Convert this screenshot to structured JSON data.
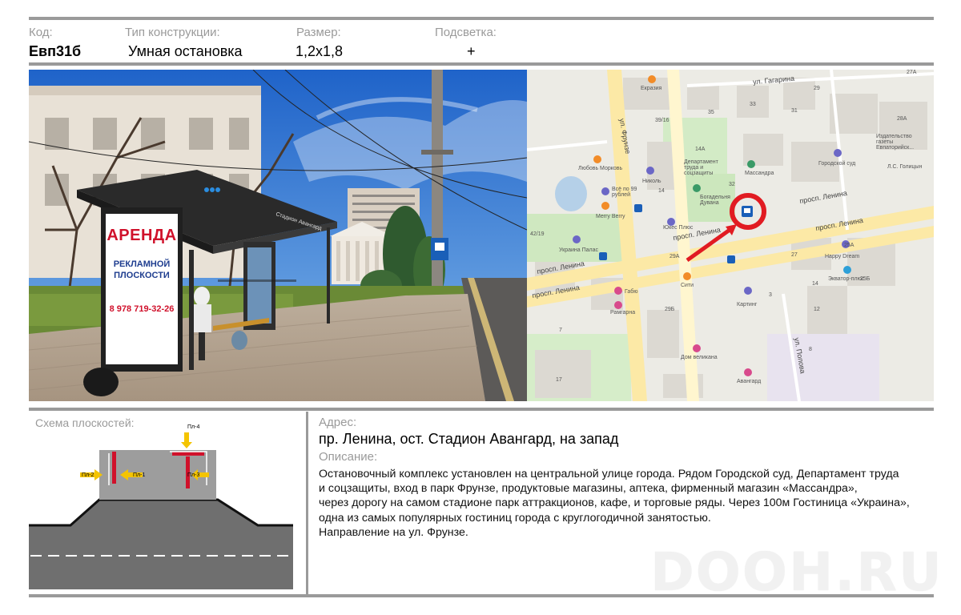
{
  "header": {
    "code_label": "Код:",
    "code_value": "Евп31б",
    "type_label": "Тип конструкции:",
    "type_value": "Умная остановка",
    "size_label": "Размер:",
    "size_value": "1,2x1,8",
    "light_label": "Подсветка:",
    "light_value": "+"
  },
  "photo": {
    "billboard_line1": "АРЕНДА",
    "billboard_line2": "РЕКЛАМНОЙ",
    "billboard_line3": "ПЛОСКОСТИ",
    "billboard_phone": "8 978 719-32-26",
    "shelter_sign": "Стадион Авангард"
  },
  "map": {
    "streets": {
      "lenina_1": "просп. Ленина",
      "lenina_2": "просп. Ленина",
      "lenina_3": "просп. Ленина",
      "lenina_4": "просп. Ленина",
      "frunze": "ул. Фрунзе",
      "gagarina": "ул. Гагарина",
      "popova": "ул. Попова"
    },
    "places": {
      "ekrazia": "Екразия",
      "lyubov": "Любовь Морковь",
      "nikol": "Николь",
      "vse99": "Всё по 99 рублей",
      "merry": "Merry Berry",
      "department": "Департамент труда и соцзащиты",
      "massandra": "Массандра",
      "dubrava": "Богадельня Дувана",
      "sud": "Городской суд",
      "izdatelstvo": "Издательство газеты Евпаторийск...",
      "golitsyn": "Л.С. Голицын",
      "ukraina": "Украина Палас",
      "yukes": "Юкес Плюс",
      "happy": "Happy Dream",
      "sity": "Сити",
      "fabio": "Габю",
      "ramgarna": "Рамгарна",
      "karting": "Картинг",
      "ekvator": "Экватор-плюс",
      "dom_velikana": "Дом великана",
      "avangard": "Авангард"
    },
    "numbers": {
      "n29": "29",
      "n33": "33",
      "n35": "35",
      "n31": "31",
      "n3916": "39/16",
      "n14a": "14А",
      "n28a": "28А",
      "n27a": "27А",
      "n14": "14",
      "n32": "32",
      "n4219": "42/19",
      "n29a": "29А",
      "n27": "27",
      "n25a": "25А",
      "n25b": "25Б",
      "n14b": "14",
      "n12": "12",
      "n8": "8",
      "n3": "3",
      "n29b": "29Б",
      "n17": "17",
      "n7": "7"
    }
  },
  "scheme": {
    "title": "Схема плоскостей:",
    "p1": "Пл-1",
    "p2": "Пл-2",
    "p3": "Пл-3",
    "p4": "Пл-4"
  },
  "address": {
    "label": "Адрес:",
    "value": "пр. Ленина, ост. Стадион Авангард, на запад"
  },
  "description": {
    "label": "Описание:",
    "lines": [
      "Остановочный комплекс установлен на центральной улице города. Рядом Городской суд, Департамент труда",
      "и соцзащиты, вход в парк Фрунзе, продуктовые магазины, аптека, фирменный магазин «Массандра»,",
      "через дорогу на самом стадионе парк аттракционов, кафе, и торговые ряды. Через 100м Гостиница «Украина»,",
      "одна из самых популярных гостиниц города с круглогодичной занятостью.",
      "Направление на ул. Фрунзе."
    ]
  },
  "watermark": "DOOH.RU",
  "colors": {
    "rule": "#9a9a9a",
    "label": "#9a9a9a",
    "billboard_red": "#d0112b",
    "billboard_blue": "#1e3d8f",
    "map_road": "#fce9a6",
    "map_marker": "#e11b22",
    "scheme_box": "#9d9d9d",
    "scheme_road": "#6f6f6f"
  },
  "icons": [
    "bus-stop-icon",
    "arrow-icon",
    "location-circle-icon",
    "poi-icons"
  ]
}
